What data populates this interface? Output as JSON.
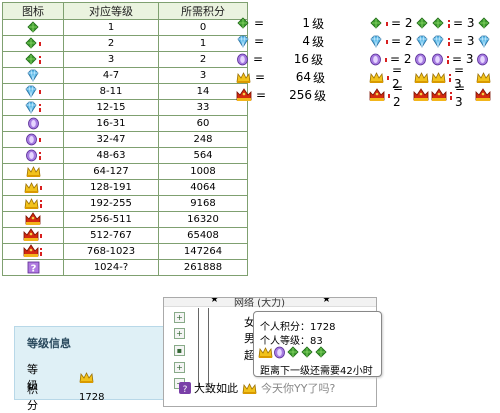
{
  "table": {
    "headers": [
      "图标",
      "对应等级",
      "所需积分"
    ],
    "rows": [
      {
        "icons": [
          "leaf"
        ],
        "level": "1",
        "points": "0"
      },
      {
        "icons": [
          "leaf",
          "dot"
        ],
        "level": "2",
        "points": "1"
      },
      {
        "icons": [
          "leaf",
          "dots"
        ],
        "level": "3",
        "points": "2"
      },
      {
        "icons": [
          "diamond"
        ],
        "level": "4-7",
        "points": "3"
      },
      {
        "icons": [
          "diamond",
          "dot"
        ],
        "level": "8-11",
        "points": "14"
      },
      {
        "icons": [
          "diamond",
          "dots"
        ],
        "level": "12-15",
        "points": "33"
      },
      {
        "icons": [
          "gem"
        ],
        "level": "16-31",
        "points": "60"
      },
      {
        "icons": [
          "gem",
          "dot"
        ],
        "level": "32-47",
        "points": "248"
      },
      {
        "icons": [
          "gem",
          "dots"
        ],
        "level": "48-63",
        "points": "564"
      },
      {
        "icons": [
          "crown"
        ],
        "level": "64-127",
        "points": "1008"
      },
      {
        "icons": [
          "crown",
          "dot"
        ],
        "level": "128-191",
        "points": "4064"
      },
      {
        "icons": [
          "crown",
          "dots"
        ],
        "level": "192-255",
        "points": "9168"
      },
      {
        "icons": [
          "bigcrown"
        ],
        "level": "256-511",
        "points": "16320"
      },
      {
        "icons": [
          "bigcrown",
          "dot"
        ],
        "level": "512-767",
        "points": "65408"
      },
      {
        "icons": [
          "bigcrown",
          "dots"
        ],
        "level": "768-1023",
        "points": "147264"
      },
      {
        "icons": [
          "question"
        ],
        "level": "1024-?",
        "points": "261888"
      }
    ]
  },
  "legend": [
    {
      "icon": "leaf",
      "eq": "=",
      "num": "1",
      "unit": "级"
    },
    {
      "icon": "diamond",
      "eq": "=",
      "num": "4",
      "unit": "级"
    },
    {
      "icon": "gem",
      "eq": "=",
      "num": "16",
      "unit": "级"
    },
    {
      "icon": "crown",
      "eq": "=",
      "num": "64",
      "unit": "级"
    },
    {
      "icon": "bigcrown",
      "eq": "=",
      "num": "256",
      "unit": "级"
    }
  ],
  "combos": [
    {
      "icon": "leaf",
      "a": "= 2",
      "b": "= 3"
    },
    {
      "icon": "diamond",
      "a": "= 2",
      "b": "= 3"
    },
    {
      "icon": "gem",
      "a": "= 2",
      "b": "= 3"
    },
    {
      "icon": "crown",
      "a": "= 2",
      "b": "= 3"
    },
    {
      "icon": "bigcrown",
      "a": "= 2",
      "b": "= 3"
    }
  ],
  "panel": {
    "title": "等级信息",
    "level_label": "等 级",
    "points_label": "积 分",
    "points_value": "1728"
  },
  "buddy": {
    "header": "网络 (大力)",
    "rows": [
      "女",
      "男",
      "超"
    ],
    "footer_name": "大致如此",
    "footer_sig": "今天你YY了吗?"
  },
  "tooltip": {
    "line1": "个人积分：1728",
    "line2": "个人等级：83",
    "line4": "距离下一级还需要42小时"
  },
  "colors": {
    "table_border": "#7fa070",
    "header_bg": "#eaf3df",
    "panel_bg": "#dff0f6"
  }
}
